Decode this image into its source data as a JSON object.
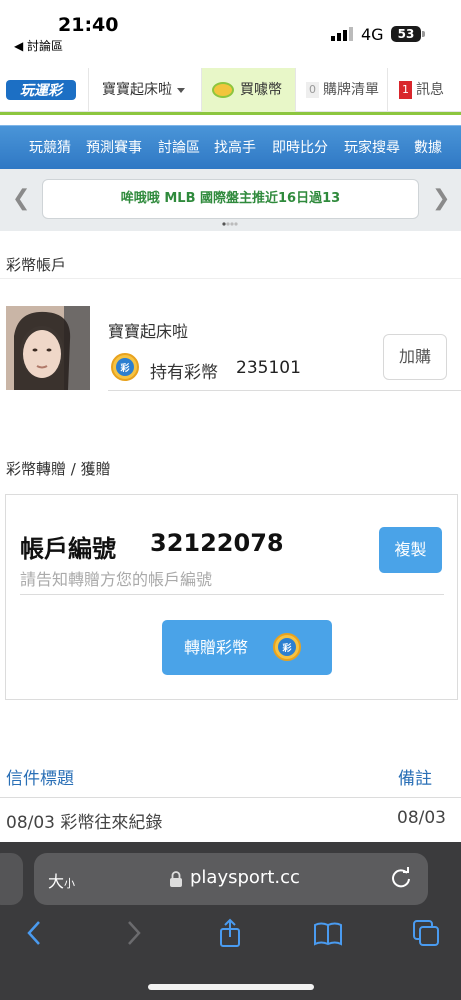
{
  "status": {
    "time": "21:40",
    "back_label": "◀ 討論區",
    "network": "4G",
    "battery": "53"
  },
  "topnav": {
    "logo_text": "玩運彩",
    "user": "寶寶起床啦",
    "buy": "買噱幣",
    "cart_count": "0",
    "cart": "購牌清單",
    "msg_count": "1",
    "msg": "訊息"
  },
  "menu": [
    "玩競猜",
    "預測賽事",
    "討論區",
    "找高手",
    "即時比分",
    "玩家搜尋",
    "數據"
  ],
  "ticker": {
    "prefix": "哞哦哦",
    "text": "MLB 國際盤主推近16日過13"
  },
  "account": {
    "section_title": "彩幣帳戶",
    "username": "寶寶起床啦",
    "coins_label": "持有彩幣",
    "coins_value": "235101",
    "add_label": "加購"
  },
  "transfer": {
    "section_title": "彩幣轉贈 / 獲贈",
    "account_label": "帳戶編號",
    "account_number": "32122078",
    "hint": "請告知轉贈方您的帳戶編號",
    "copy_label": "複製",
    "transfer_label": "轉贈彩幣"
  },
  "mail": {
    "col_title": "信件標題",
    "col_note": "備註",
    "rows": [
      {
        "title": "08/03 彩幣往來紀錄",
        "note": "08/03"
      }
    ]
  },
  "browser": {
    "text_size": "大",
    "text_size_small": "小",
    "url": "playsport.cc"
  },
  "colors": {
    "accent_blue": "#4aa3e8",
    "menu_blue": "#3a85cf",
    "green": "#8cc63f",
    "link_blue": "#2a6fb6"
  }
}
